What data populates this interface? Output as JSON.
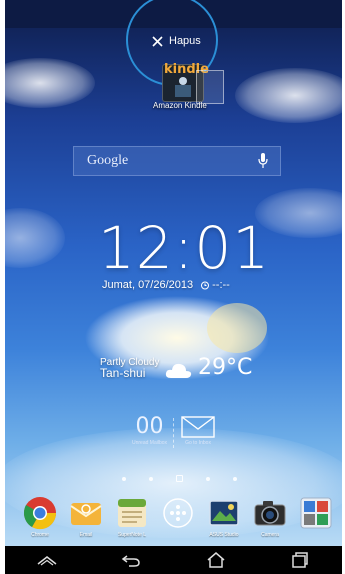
{
  "remove_zone": {
    "label": "Hapus",
    "icon": "close-icon"
  },
  "dragged_app": {
    "label": "Amazon Kindle",
    "tile_text": "kindle"
  },
  "search": {
    "brand": "Google",
    "icon": "microphone-icon"
  },
  "clock": {
    "time": "12:01",
    "date": "Jumat, 07/26/2013",
    "alarm": "--:--",
    "alarm_icon": "alarm-clock-icon"
  },
  "weather": {
    "condition": "Partly Cloudy",
    "location": "Tan-shui",
    "temperature": "29°C",
    "icon": "partly-cloudy-icon"
  },
  "mail_widget": {
    "unread_count": "00",
    "unread_label": "Unread Mailbox",
    "inbox_label": "Go to Inbox"
  },
  "pager": {
    "pages": 5,
    "active_page": 3
  },
  "dock": {
    "apps": [
      {
        "label": "Chrome",
        "icon": "chrome-icon"
      },
      {
        "label": "Email",
        "icon": "email-icon"
      },
      {
        "label": "SuperNote L",
        "icon": "supernote-icon"
      },
      {
        "label": "",
        "icon": "app-drawer-icon"
      },
      {
        "label": "ASUS Studio",
        "icon": "asus-studio-icon"
      },
      {
        "label": "Camera",
        "icon": "camera-icon"
      },
      {
        "label": "",
        "icon": "google-folder-icon"
      }
    ]
  },
  "nav": {
    "items": [
      "home-icon",
      "back-icon",
      "home-outline-icon",
      "recents-icon"
    ]
  },
  "colors": {
    "accent_ring": "#2b8fd6",
    "sky_top": "#11245a",
    "sky_bottom": "#b9dbf5"
  }
}
